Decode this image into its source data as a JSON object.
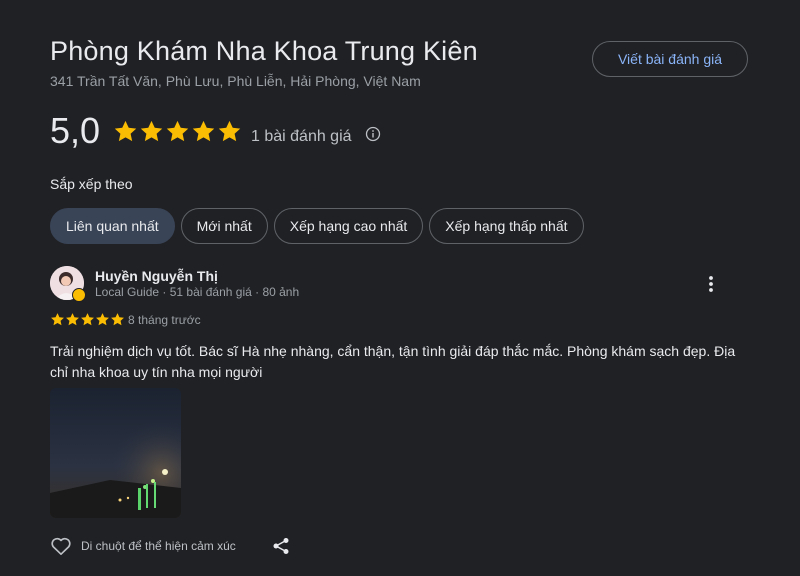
{
  "place": {
    "name": "Phòng Khám Nha Khoa Trung Kiên",
    "address": "341 Trần Tất Văn, Phù Lưu, Phù Liễn, Hải Phòng, Việt Nam",
    "write_review_label": "Viết bài đánh giá"
  },
  "rating": {
    "value": "5,0",
    "stars": 5,
    "count_label": "1 bài đánh giá",
    "star_color": "#fbbc04"
  },
  "sort": {
    "label": "Sắp xếp theo",
    "options": [
      "Liên quan nhất",
      "Mới nhất",
      "Xếp hạng cao nhất",
      "Xếp hạng thấp nhất"
    ],
    "selected": "Liên quan nhất"
  },
  "review": {
    "author": "Huyền Nguyễn Thị",
    "meta": "Local Guide · 51 bài đánh giá · 80 ảnh",
    "stars": 5,
    "time": "8 tháng trước",
    "text": "Trải nghiệm dịch vụ tốt. Bác sĩ Hà nhẹ nhàng, cẩn thận, tận tình giải đáp thắc mắc. Phòng khám sạch đẹp. Địa chỉ nha khoa uy tín nha mọi người",
    "react_label": "Di chuột để thể hiện cảm xúc"
  },
  "icons": {
    "info": "info-icon",
    "more": "more-vert-icon",
    "heart": "heart-outline-icon",
    "share": "share-icon"
  }
}
